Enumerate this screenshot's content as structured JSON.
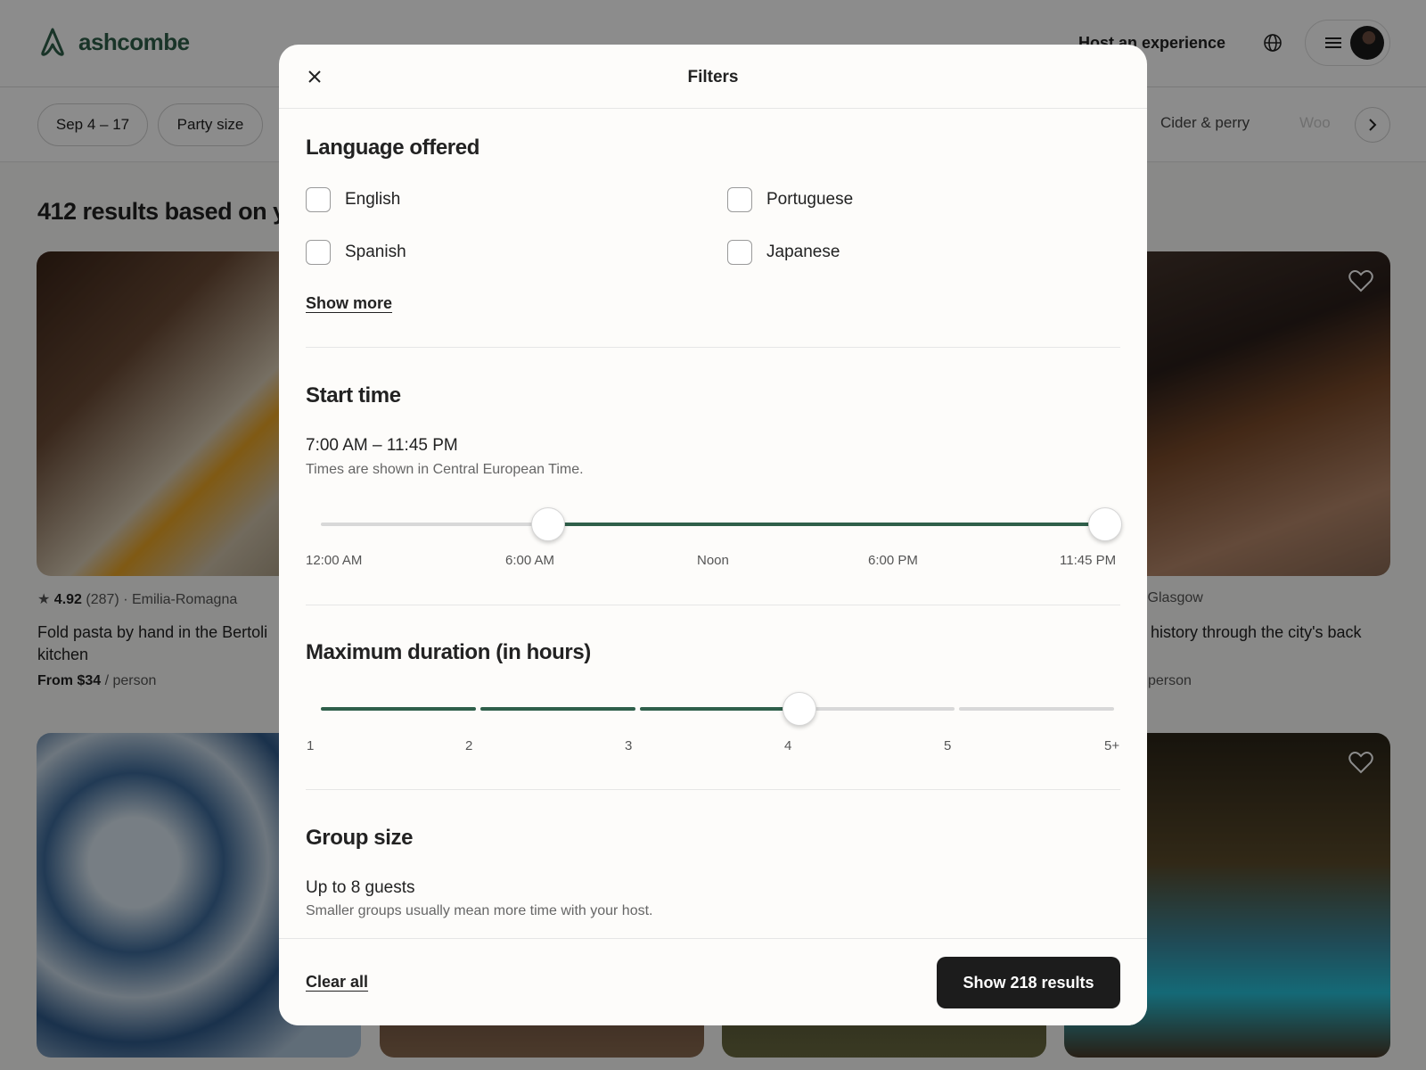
{
  "header": {
    "logo_text": "ashcombe",
    "host_link": "Host an experience",
    "icons": [
      "logo-icon",
      "globe-icon",
      "menu-icon"
    ]
  },
  "filterbar": {
    "dates": "Sep 4 – 17",
    "party_size": "Party size",
    "categories": [
      "Cider & perry",
      "Woo"
    ]
  },
  "results": {
    "title": "412 results based on yo"
  },
  "cards": [
    {
      "rating": "4.92",
      "reviews": "(287)",
      "location": "· Emilia-Romagna",
      "title_line1": "Fold pasta by hand in the Bertoli",
      "title_line2": "kitchen",
      "price_bold": "From $34",
      "price_suffix": "/ person"
    },
    {
      "meta": ") · Glasgow",
      "title_line1": "r history through the city's back",
      "price_suffix": "person"
    }
  ],
  "modal": {
    "title": "Filters",
    "language": {
      "heading": "Language offered",
      "options": [
        "English",
        "Portuguese",
        "Spanish",
        "Japanese"
      ],
      "show_more": "Show more"
    },
    "start_time": {
      "heading": "Start time",
      "value": "7:00 AM – 11:45 PM",
      "note": "Times are shown in Central European Time.",
      "ticks": [
        "12:00 AM",
        "6:00 AM",
        "Noon",
        "6:00 PM",
        "11:45 PM"
      ],
      "range_fraction": [
        0.29,
        1.0
      ]
    },
    "duration": {
      "heading": "Maximum duration (in hours)",
      "ticks": [
        "1",
        "2",
        "3",
        "4",
        "5",
        "5+"
      ],
      "selected_value": 4
    },
    "group_size": {
      "heading": "Group size",
      "value": "Up to 8 guests",
      "note": "Smaller groups usually mean more time with your host."
    },
    "footer": {
      "clear_all": "Clear all",
      "show_results": "Show 218 results"
    }
  },
  "colors": {
    "accent": "#2f5f4a",
    "primary_button": "#1c1c1c"
  }
}
